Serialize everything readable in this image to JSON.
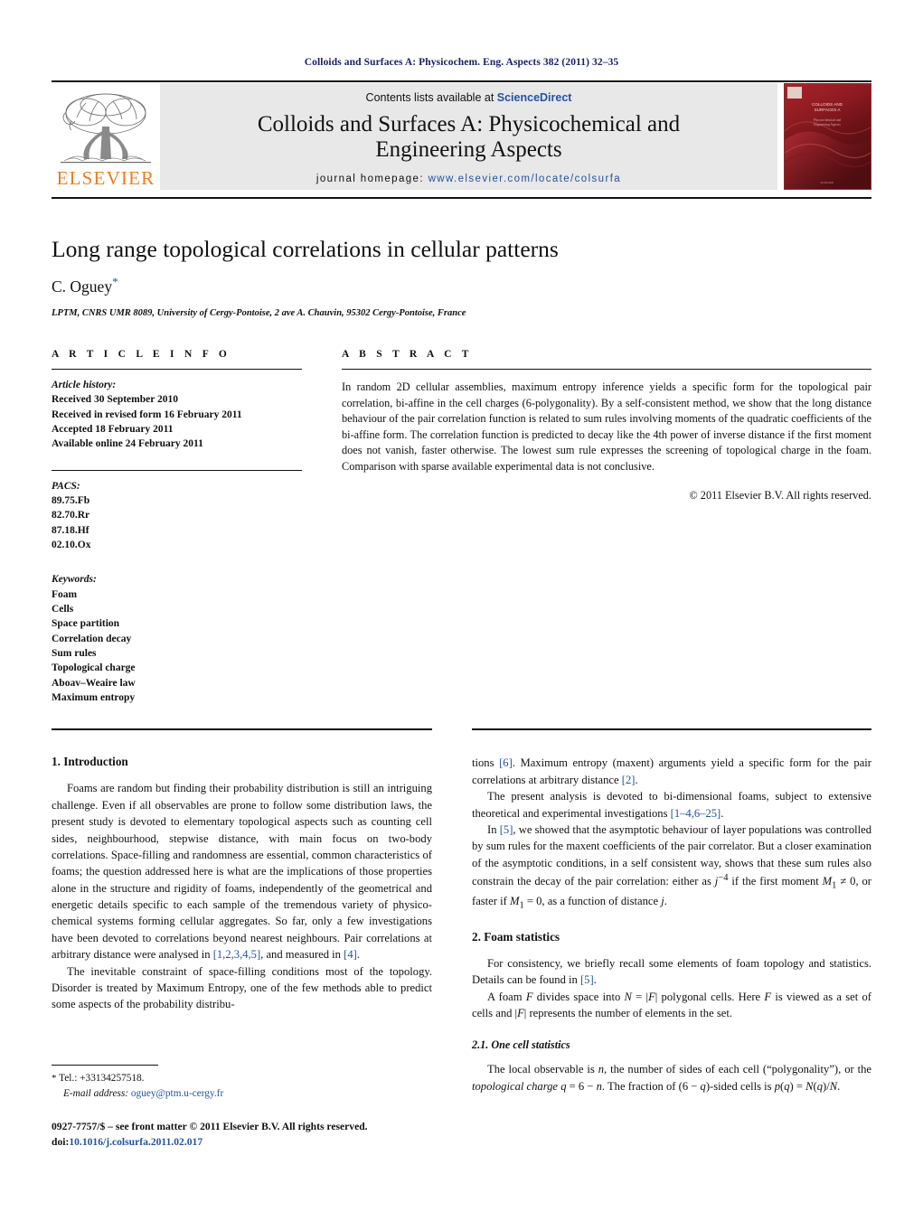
{
  "running_head": "Colloids and Surfaces A: Physicochem. Eng. Aspects 382 (2011) 32–35",
  "masthead": {
    "publisher_name": "ELSEVIER",
    "contents_prefix": "Contents lists available at ",
    "sciencedirect": "ScienceDirect",
    "journal_title": "Colloids and Surfaces A: Physicochemical and Engineering Aspects",
    "homepage_label": "journal homepage: ",
    "homepage_url": "www.elsevier.com/locate/colsurfa",
    "cover_title_line1": "COLLOIDS AND",
    "cover_title_line2": "SURFACES A",
    "cover_subtitle": "Physicochemical and Engineering Aspects",
    "cover_color": "#9e1b20"
  },
  "title_block": {
    "title": "Long range topological correlations in cellular patterns",
    "author": "C. Oguey",
    "corresponding_mark": "*",
    "affiliation": "LPTM, CNRS UMR 8089, University of Cergy-Pontoise, 2 ave A. Chauvin, 95302 Cergy-Pontoise, France"
  },
  "article_info": {
    "heading": "A R T I C L E   I N F O",
    "history_label": "Article history:",
    "history": [
      "Received 30 September 2010",
      "Received in revised form 16 February 2011",
      "Accepted 18 February 2011",
      "Available online 24 February 2011"
    ],
    "pacs_label": "PACS:",
    "pacs": [
      "89.75.Fb",
      "82.70.Rr",
      "87.18.Hf",
      "02.10.Ox"
    ],
    "keywords_label": "Keywords:",
    "keywords": [
      "Foam",
      "Cells",
      "Space partition",
      "Correlation decay",
      "Sum rules",
      "Topological charge",
      "Aboav–Weaire law",
      "Maximum entropy"
    ]
  },
  "abstract": {
    "heading": "A B S T R A C T",
    "text": "In random 2D cellular assemblies, maximum entropy inference yields a specific form for the topological pair correlation, bi-affine in the cell charges (6-polygonality). By a self-consistent method, we show that the long distance behaviour of the pair correlation function is related to sum rules involving moments of the quadratic coefficients of the bi-affine form. The correlation function is predicted to decay like the 4th power of inverse distance if the first moment does not vanish, faster otherwise. The lowest sum rule expresses the screening of topological charge in the foam. Comparison with sparse available experimental data is not conclusive.",
    "copyright": "© 2011 Elsevier B.V. All rights reserved."
  },
  "body": {
    "section1_heading": "1.  Introduction",
    "p1_a": "Foams are random but finding their probability distribution is still an intriguing challenge. Even if all observables are prone to follow some distribution laws, the present study is devoted to elementary topological aspects such as counting cell sides, neighbourhood, stepwise distance, with main focus on two-body correlations. Space-filling and randomness are essential, common characteristics of foams; the question addressed here is what are the implications of those properties alone in the structure and rigidity of foams, independently of the geometrical and energetic details specific to each sample of the tremendous variety of physico-chemical systems forming cellular aggregates. So far, only a few investigations have been devoted to correlations beyond nearest neighbours. Pair correlations at arbitrary distance were analysed in ",
    "p1_ref1": "[1,2,3,4,5]",
    "p1_b": ", and measured in ",
    "p1_ref2": "[4]",
    "p1_c": ".",
    "p2_a": "The inevitable constraint of space-filling conditions most of the topology. Disorder is treated by Maximum Entropy, one of the few methods able to predict some aspects of the probability distribu-",
    "p2_cont_a": "tions ",
    "p2_cont_ref": "[6]",
    "p2_cont_b": ". Maximum entropy (maxent) arguments yield a specific form for the pair correlations at arbitrary distance ",
    "p2_cont_ref2": "[2]",
    "p2_cont_c": ".",
    "p3_a": "The present analysis is devoted to bi-dimensional foams, subject to extensive theoretical and experimental investigations ",
    "p3_ref": "[1–4,6–25]",
    "p3_b": ".",
    "p4_a": "In ",
    "p4_ref": "[5]",
    "p4_b": ", we showed that the asymptotic behaviour of layer populations was controlled by sum rules for the maxent coefficients of the pair correlator. But a closer examination of the asymptotic conditions, in a self consistent way, shows that these sum rules also constrain the decay of the pair correlation: either as ",
    "p4_math1": "j",
    "p4_math1_sup": "−4",
    "p4_c": " if the first moment ",
    "p4_math2": "M",
    "p4_math2_sub": "1",
    "p4_d": " ≠ 0, or faster if ",
    "p4_math3": "M",
    "p4_math3_sub": "1",
    "p4_e": " = 0, as a function of distance ",
    "p4_math4": "j",
    "p4_f": ".",
    "section2_heading": "2.  Foam statistics",
    "p5_a": "For consistency, we briefly recall some elements of foam topology and statistics. Details can be found in ",
    "p5_ref": "[5]",
    "p5_b": ".",
    "p6_a": "A foam ",
    "p6_f1": "F",
    "p6_b": " divides space into ",
    "p6_math": "N",
    "p6_c": " = |",
    "p6_f2": "F",
    "p6_d": "| polygonal cells. Here ",
    "p6_f3": "F",
    "p6_e": " is viewed as a set of cells and |",
    "p6_f4": "F",
    "p6_g": "| represents the number of elements in the set.",
    "subsection21_heading": "2.1.  One cell statistics",
    "p7_a": "The local observable is ",
    "p7_n": "n",
    "p7_b": ", the number of sides of each cell (“polygonality”), or the ",
    "p7_ital": "topological charge",
    "p7_c": " ",
    "p7_q": "q",
    "p7_d": " = 6 − ",
    "p7_n2": "n",
    "p7_e": ". The fraction of (6 − ",
    "p7_q2": "q",
    "p7_f": ")-sided cells is ",
    "p7_p": "p",
    "p7_g": "(",
    "p7_q3": "q",
    "p7_h": ") = ",
    "p7_N": "N",
    "p7_i": "(",
    "p7_q4": "q",
    "p7_j": ")/",
    "p7_N2": "N",
    "p7_k": "."
  },
  "footnote": {
    "star": "*",
    "tel": "Tel.: +33134257518.",
    "email_label": "E-mail address:",
    "email": "oguey@ptm.u-cergy.fr"
  },
  "imprint": {
    "line1": "0927-7757/$ – see front matter © 2011 Elsevier B.V. All rights reserved.",
    "doi_label": "doi:",
    "doi": "10.1016/j.colsurfa.2011.02.017"
  }
}
